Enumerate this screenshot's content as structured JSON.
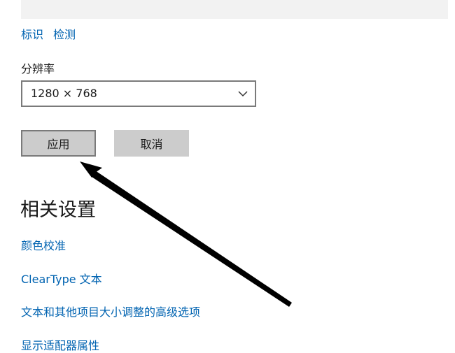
{
  "links": {
    "identify": "标识",
    "detect": "检测"
  },
  "resolution": {
    "label": "分辨率",
    "value": "1280 × 768"
  },
  "buttons": {
    "apply": "应用",
    "cancel": "取消"
  },
  "related": {
    "title": "相关设置",
    "items": [
      "颜色校准",
      "ClearType 文本",
      "文本和其他项目大小调整的高级选项",
      "显示适配器属性"
    ]
  },
  "colors": {
    "link": "#0063b1",
    "button_bg": "#cccccc",
    "arrow": "#000000"
  },
  "icons": {
    "dropdown": "chevron-down-icon",
    "annotation": "arrow-pointer-icon"
  }
}
